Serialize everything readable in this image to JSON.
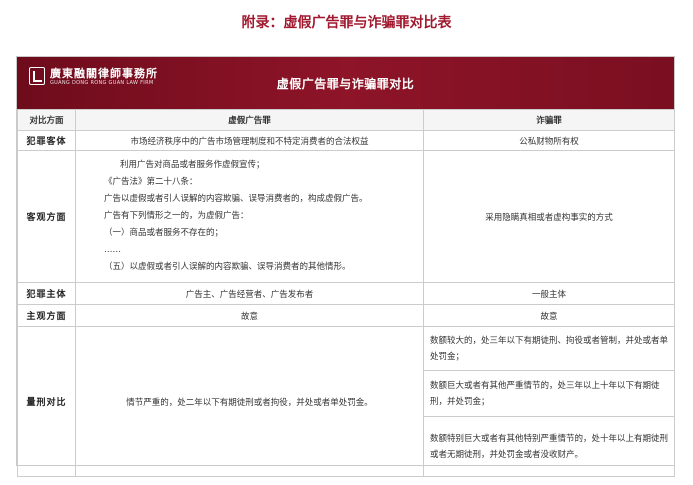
{
  "page_title": "附录：虚假广告罪与诈骗罪对比表",
  "logo": {
    "name_cn": "廣東融關律師事務所",
    "name_en": "GUANG DONG RONG GUAN LAW FIRM"
  },
  "banner_title": "虚假广告罪与诈骗罪对比",
  "table": {
    "headers": [
      "对比方面",
      "虚假广告罪",
      "诈骗罪"
    ],
    "rows": {
      "object": {
        "label": "犯罪客体",
        "false_ad": "市场经济秩序中的广告市场管理制度和不特定消费者的合法权益",
        "fraud": "公私财物所有权"
      },
      "objective": {
        "label": "客观方面",
        "false_ad_lines": [
          "利用广告对商品或者服务作虚假宣传；",
          "《广告法》第二十八条：",
          "广告以虚假或者引人误解的内容欺骗、误导消费者的，构成虚假广告。",
          "广告有下列情形之一的，为虚假广告：",
          "（一）商品或者服务不存在的；",
          "……",
          "（五）以虚假或者引人误解的内容欺骗、误导消费者的其他情形。"
        ],
        "fraud": "采用隐瞒真相或者虚构事实的方式"
      },
      "subject": {
        "label": "犯罪主体",
        "false_ad": "广告主、广告经营者、广告发布者",
        "fraud": "一般主体"
      },
      "subjective": {
        "label": "主观方面",
        "false_ad": "故意",
        "fraud": "故意"
      },
      "penalty": {
        "label": "量刑对比",
        "false_ad": "情节严重的，处二年以下有期徒刑或者拘役，并处或者单处罚金。",
        "fraud_items": [
          "数额较大的，处三年以下有期徒刑、拘役或者管制，并处或者单处罚金；",
          "数额巨大或者有其他严重情节的，处三年以上十年以下有期徒刑，并处罚金；",
          "数额特别巨大或者有其他特别严重情节的，处十年以上有期徒刑或者无期徒刑，并处罚金或者没收财产。"
        ]
      }
    }
  }
}
